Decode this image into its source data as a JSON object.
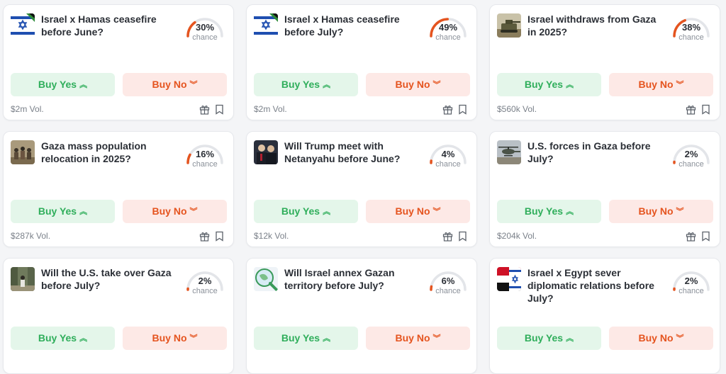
{
  "markets": [
    {
      "title": "Israel x Hamas ceasefire before June?",
      "percent": 30,
      "pct_label": "30%",
      "chance_label": "chance",
      "buy_yes": "Buy Yes",
      "buy_no": "Buy No",
      "volume": "$2m Vol.",
      "image": "israel-hamas-flag"
    },
    {
      "title": "Israel x Hamas ceasefire before July?",
      "percent": 49,
      "pct_label": "49%",
      "chance_label": "chance",
      "buy_yes": "Buy Yes",
      "buy_no": "Buy No",
      "volume": "$2m Vol.",
      "image": "israel-hamas-flag"
    },
    {
      "title": "Israel withdraws from Gaza in 2025?",
      "percent": 38,
      "pct_label": "38%",
      "chance_label": "chance",
      "buy_yes": "Buy Yes",
      "buy_no": "Buy No",
      "volume": "$560k Vol.",
      "image": "tank-photo"
    },
    {
      "title": "Gaza mass population relocation in 2025?",
      "percent": 16,
      "pct_label": "16%",
      "chance_label": "chance",
      "buy_yes": "Buy Yes",
      "buy_no": "Buy No",
      "volume": "$287k Vol.",
      "image": "crowd-photo"
    },
    {
      "title": "Will Trump meet with Netanyahu before June?",
      "percent": 4,
      "pct_label": "4%",
      "chance_label": "chance",
      "buy_yes": "Buy Yes",
      "buy_no": "Buy No",
      "volume": "$12k Vol.",
      "image": "leaders-photo"
    },
    {
      "title": "U.S. forces in Gaza before July?",
      "percent": 2,
      "pct_label": "2%",
      "chance_label": "chance",
      "buy_yes": "Buy Yes",
      "buy_no": "Buy No",
      "volume": "$204k Vol.",
      "image": "helicopter-photo"
    },
    {
      "title": "Will the U.S. take over Gaza before July?",
      "percent": 2,
      "pct_label": "2%",
      "chance_label": "chance",
      "buy_yes": "Buy Yes",
      "buy_no": "Buy No",
      "volume": "",
      "image": "street-photo"
    },
    {
      "title": "Will Israel annex Gazan territory before July?",
      "percent": 6,
      "pct_label": "6%",
      "chance_label": "chance",
      "buy_yes": "Buy Yes",
      "buy_no": "Buy No",
      "volume": "",
      "image": "map-photo"
    },
    {
      "title": "Israel x Egypt sever diplomatic relations before July?",
      "percent": 2,
      "pct_label": "2%",
      "chance_label": "chance",
      "buy_yes": "Buy Yes",
      "buy_no": "Buy No",
      "volume": "",
      "image": "israel-egypt-flags"
    }
  ],
  "colors": {
    "yes_text": "#2fae5b",
    "yes_bg": "#e4f6ea",
    "no_text": "#e5541f",
    "no_bg": "#fde9e6",
    "gauge_fill": "#e5541f",
    "gauge_track": "#e3e5e9"
  },
  "icons": {
    "yes_arrow": "double-chevron-up-icon",
    "no_arrow": "double-chevron-down-icon",
    "gift": "gift-icon",
    "bookmark": "bookmark-icon"
  }
}
